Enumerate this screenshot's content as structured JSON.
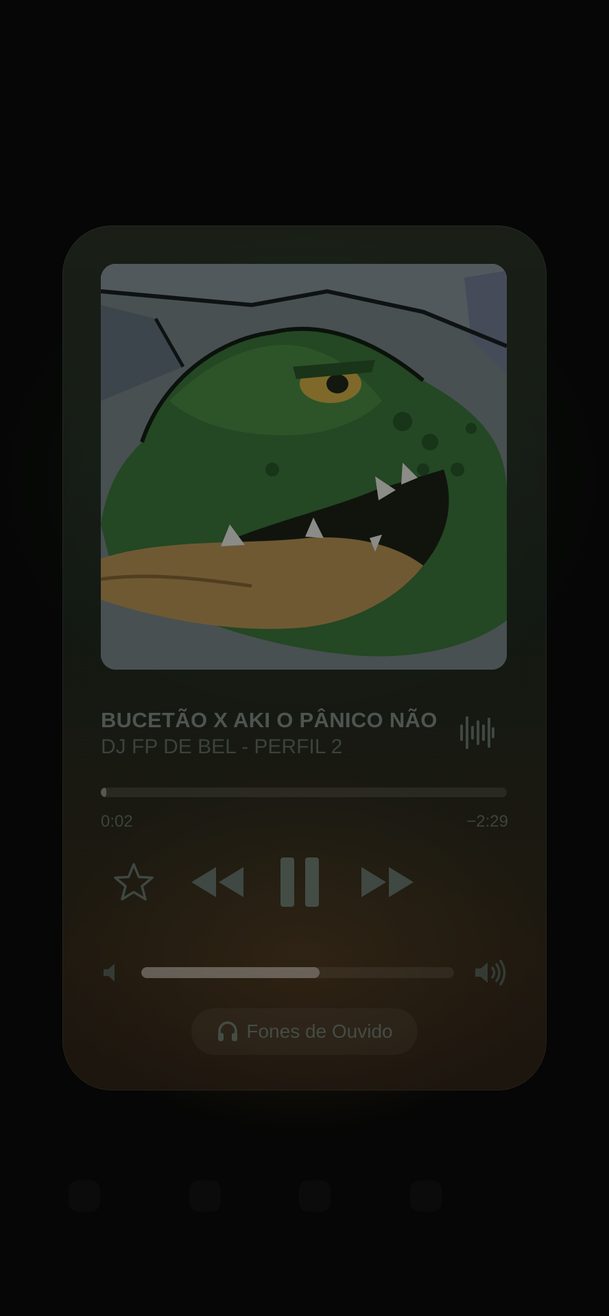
{
  "now_playing": {
    "title": "BUCETÃO X AKI O PÂNICO NÃO",
    "artist": "DJ FP DE BEL - PERFIL 2",
    "artwork_icon": "album-artwork-green-creature",
    "waveform_icon": "waveform-icon"
  },
  "progress": {
    "elapsed": "0:02",
    "remaining": "−2:29",
    "fraction": 0.013
  },
  "controls": {
    "star_icon": "star-icon",
    "rewind_icon": "rewind-icon",
    "pause_icon": "pause-icon",
    "forward_icon": "fast-forward-icon"
  },
  "volume": {
    "level": 0.57,
    "low_icon": "speaker-low-icon",
    "high_icon": "speaker-high-icon"
  },
  "output": {
    "label": "Fones de Ouvido",
    "icon": "headphones-icon"
  },
  "colors": {
    "accent_icon": "#3f4842",
    "text_primary": "#4d5550",
    "text_secondary": "#3a433c"
  }
}
